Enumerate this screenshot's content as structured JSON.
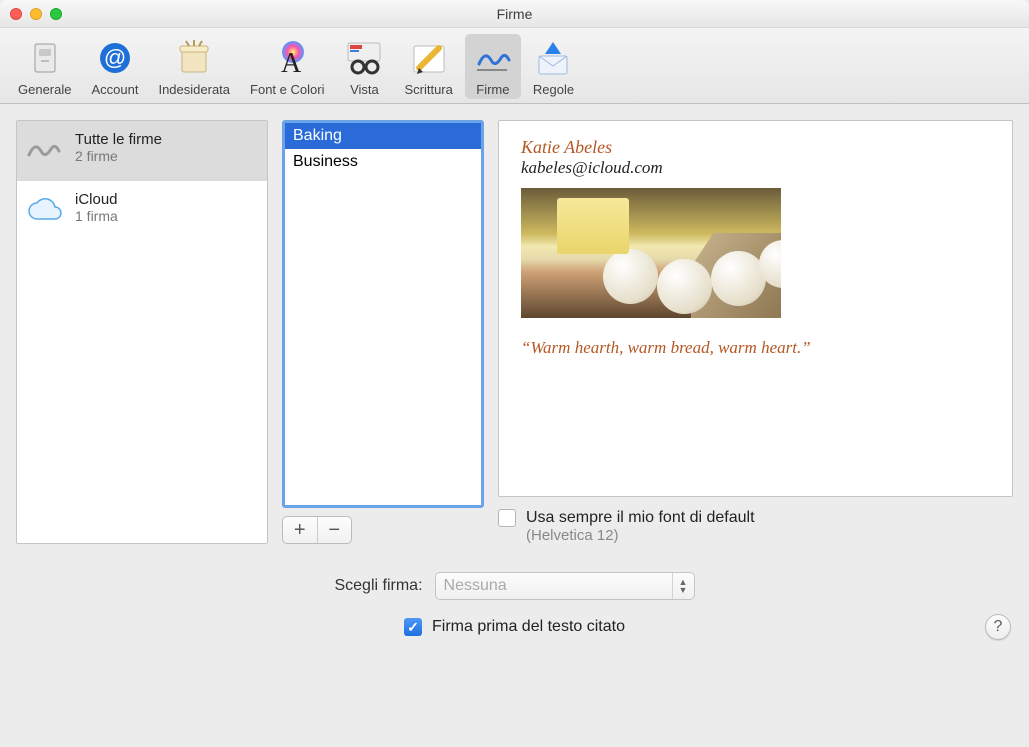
{
  "window": {
    "title": "Firme"
  },
  "toolbar": {
    "items": [
      {
        "label": "Generale",
        "icon": "general-icon"
      },
      {
        "label": "Account",
        "icon": "at-icon"
      },
      {
        "label": "Indesiderata",
        "icon": "junk-icon"
      },
      {
        "label": "Font e Colori",
        "icon": "fonts-icon"
      },
      {
        "label": "Vista",
        "icon": "view-icon"
      },
      {
        "label": "Scrittura",
        "icon": "compose-icon"
      },
      {
        "label": "Firme",
        "icon": "signature-icon"
      },
      {
        "label": "Regole",
        "icon": "rules-icon"
      }
    ],
    "selected_index": 6
  },
  "accounts": {
    "items": [
      {
        "title": "Tutte le firme",
        "subtitle": "2 firme",
        "icon": "signature-icon",
        "selected": true
      },
      {
        "title": "iCloud",
        "subtitle": "1 firma",
        "icon": "icloud-icon",
        "selected": false
      }
    ]
  },
  "signatures": {
    "items": [
      {
        "name": "Baking",
        "selected": true
      },
      {
        "name": "Business",
        "selected": false
      }
    ]
  },
  "preview": {
    "name": "Katie Abeles",
    "email": "kabeles@icloud.com",
    "quote": "“Warm hearth, warm bread, warm heart.”"
  },
  "default_font": {
    "checked": false,
    "label": "Usa sempre il mio font di default",
    "detail": "(Helvetica 12)"
  },
  "footer": {
    "choose_label": "Scegli firma:",
    "choose_value": "Nessuna",
    "cite_checked": true,
    "cite_label": "Firma prima del testo citato"
  },
  "buttons": {
    "add": "+",
    "remove": "−",
    "help": "?"
  }
}
